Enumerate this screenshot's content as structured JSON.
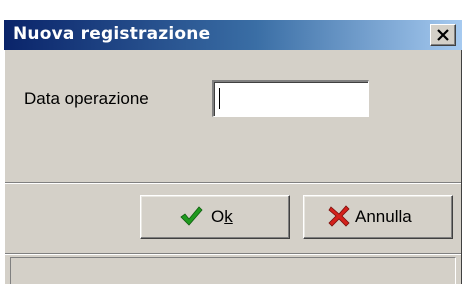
{
  "dialog": {
    "title": "Nuova registrazione",
    "close_icon": "close-icon"
  },
  "form": {
    "date_label": "Data operazione",
    "date_value": ""
  },
  "buttons": {
    "ok_prefix": "O",
    "ok_mnemonic": "k",
    "ok_icon": "checkmark-icon",
    "ok_icon_color": "#1f9a1f",
    "cancel_label": "Annulla",
    "cancel_icon": "red-x-icon",
    "cancel_icon_color": "#d4211c"
  },
  "theme": {
    "titlebar_start": "#0a246a",
    "titlebar_end": "#a6caf0",
    "face": "#d4d0c8"
  }
}
